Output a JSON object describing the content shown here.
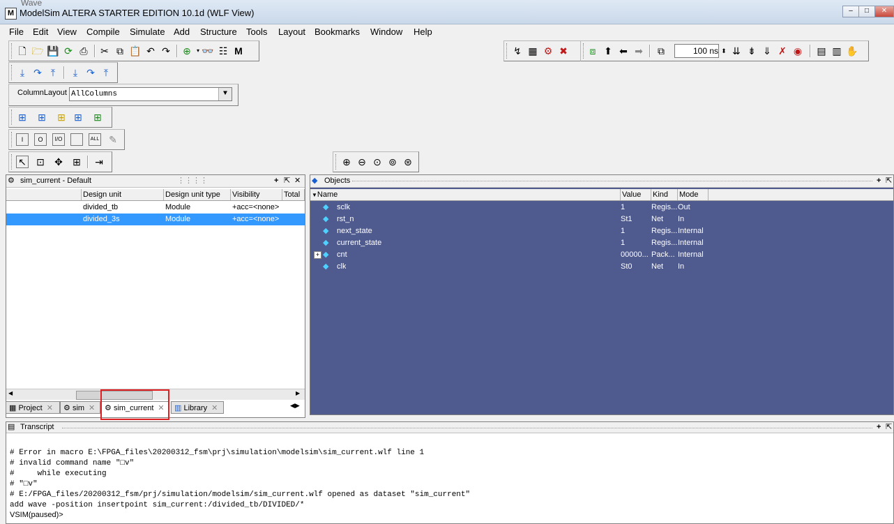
{
  "window": {
    "behind_title": "Wave",
    "app_icon_letter": "M",
    "title": "ModelSim ALTERA STARTER EDITION 10.1d (WLF View)",
    "controls": [
      "–",
      "□",
      "✕"
    ]
  },
  "menu": [
    "File",
    "Edit",
    "View",
    "Compile",
    "Simulate",
    "Add",
    "Structure",
    "Tools",
    "Layout",
    "Bookmarks",
    "Window",
    "Help"
  ],
  "toolbar": {
    "column_layout_label": "ColumnLayout",
    "column_layout_value": "AllColumns",
    "time_value": "100 ns",
    "filter_labels": [
      "I",
      "O",
      "I/O",
      "",
      "ALL"
    ]
  },
  "structure_pane": {
    "title": "sim_current - Default",
    "columns": [
      "Design unit",
      "Design unit type",
      "Visibility",
      "Total"
    ],
    "rows": [
      {
        "name": "divided_tb",
        "type": "Module",
        "visibility": "+acc=<none>",
        "selected": false
      },
      {
        "name": "divided_3s",
        "type": "Module",
        "visibility": "+acc=<none>",
        "selected": true
      }
    ],
    "tabs": [
      "Project",
      "sim",
      "sim_current",
      "Library"
    ],
    "active_tab": "sim_current"
  },
  "objects_pane": {
    "title": "Objects",
    "columns": [
      "Name",
      "Value",
      "Kind",
      "Mode"
    ],
    "rows": [
      {
        "name": "sclk",
        "value": "1",
        "kind": "Regis...",
        "mode": "Out",
        "expand": false
      },
      {
        "name": "rst_n",
        "value": "St1",
        "kind": "Net",
        "mode": "In",
        "expand": false
      },
      {
        "name": "next_state",
        "value": "1",
        "kind": "Regis...",
        "mode": "Internal",
        "expand": false
      },
      {
        "name": "current_state",
        "value": "1",
        "kind": "Regis...",
        "mode": "Internal",
        "expand": false
      },
      {
        "name": "cnt",
        "value": "00000...",
        "kind": "Pack...",
        "mode": "Internal",
        "expand": true
      },
      {
        "name": "clk",
        "value": "St0",
        "kind": "Net",
        "mode": "In",
        "expand": false
      }
    ]
  },
  "transcript": {
    "title": "Transcript",
    "lines": [
      "# Error in macro E:\\FPGA_files\\20200312_fsm\\prj\\simulation\\modelsim\\sim_current.wlf line 1",
      "# invalid command name \"□v\"",
      "#     while executing",
      "# \"□v\"",
      "# E:/FPGA_files/20200312_fsm/prj/simulation/modelsim/sim_current.wlf opened as dataset \"sim_current\"",
      "add wave -position insertpoint sim_current:/divided_tb/DIVIDED/*"
    ],
    "prompt": "VSIM(paused)>"
  },
  "highlight_color": "#e02020",
  "objects_bg_color": "#4f5a8f"
}
